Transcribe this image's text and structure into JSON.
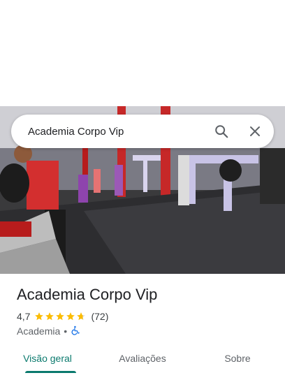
{
  "search": {
    "query": "Academia Corpo Vip"
  },
  "place": {
    "name": "Academia Corpo Vip",
    "rating": "4,7",
    "rating_value": 4.7,
    "stars_max": 5,
    "review_count": "(72)",
    "category": "Academia",
    "separator": "•",
    "accessibility_icon": "wheelchair-icon"
  },
  "tabs": [
    {
      "label": "Visão geral",
      "active": true
    },
    {
      "label": "Avaliações",
      "active": false
    },
    {
      "label": "Sobre",
      "active": false
    }
  ],
  "colors": {
    "accent": "#0b7a6e",
    "star": "#fbbc04",
    "accessibility": "#1a73e8"
  }
}
